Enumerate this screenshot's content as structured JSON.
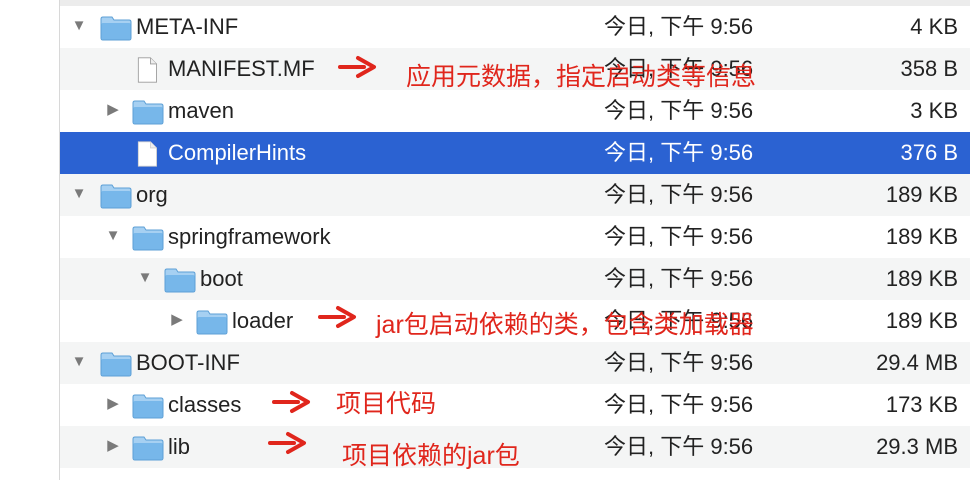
{
  "rows": [
    {
      "name": "META-INF",
      "date": "今日, 下午 9:56",
      "size": "4 KB",
      "type": "folder",
      "disclosure": "expanded"
    },
    {
      "name": "MANIFEST.MF",
      "date": "今日, 下午 9:56",
      "size": "358 B",
      "type": "file",
      "disclosure": "none"
    },
    {
      "name": "maven",
      "date": "今日, 下午 9:56",
      "size": "3 KB",
      "type": "folder",
      "disclosure": "collapsed"
    },
    {
      "name": "CompilerHints",
      "date": "今日, 下午 9:56",
      "size": "376 B",
      "type": "file",
      "disclosure": "none",
      "selected": true
    },
    {
      "name": "org",
      "date": "今日, 下午 9:56",
      "size": "189 KB",
      "type": "folder",
      "disclosure": "expanded"
    },
    {
      "name": "springframework",
      "date": "今日, 下午 9:56",
      "size": "189 KB",
      "type": "folder",
      "disclosure": "expanded"
    },
    {
      "name": "boot",
      "date": "今日, 下午 9:56",
      "size": "189 KB",
      "type": "folder",
      "disclosure": "expanded"
    },
    {
      "name": "loader",
      "date": "今日, 下午 9:56",
      "size": "189 KB",
      "type": "folder",
      "disclosure": "collapsed"
    },
    {
      "name": "BOOT-INF",
      "date": "今日, 下午 9:56",
      "size": "29.4 MB",
      "type": "folder",
      "disclosure": "expanded"
    },
    {
      "name": "classes",
      "date": "今日, 下午 9:56",
      "size": "173 KB",
      "type": "folder",
      "disclosure": "collapsed"
    },
    {
      "name": "lib",
      "date": "今日, 下午 9:56",
      "size": "29.3 MB",
      "type": "folder",
      "disclosure": "collapsed"
    }
  ],
  "annotations": {
    "manifest": "应用元数据，指定启动类等信息",
    "loader": "jar包启动依赖的类，包含类加载器",
    "classes": "项目代码",
    "lib": "项目依赖的jar包"
  },
  "colors": {
    "selection": "#2b62d2",
    "folder": "#6ab0e6",
    "annotation": "#e0261c",
    "alt_row": "#f4f5f5"
  },
  "icons": {
    "folder": "folder-icon",
    "file": "document-icon",
    "expanded": "triangle-down-icon",
    "collapsed": "triangle-right-icon",
    "annotation_arrow": "arrow-right-icon"
  }
}
